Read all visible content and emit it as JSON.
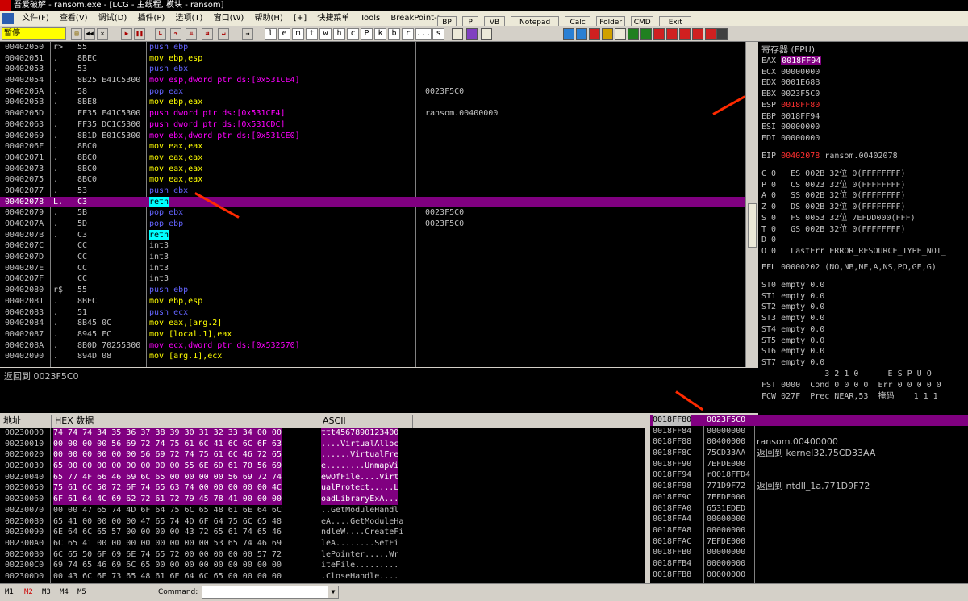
{
  "title": "吾爱破解 - ransom.exe - [LCG - 主线程, 模块 - ransom]",
  "menu": [
    "文件(F)",
    "查看(V)",
    "调试(D)",
    "插件(P)",
    "选项(T)",
    "窗口(W)",
    "帮助(H)",
    "[+]",
    "快捷菜单",
    "Tools",
    "BreakPoint->"
  ],
  "tool_buttons": [
    "BP",
    "P",
    "VB",
    "Notepad",
    "Calc",
    "Folder",
    "CMD",
    "Exit"
  ],
  "status": "暂停",
  "letter_buttons": [
    "l",
    "e",
    "m",
    "t",
    "w",
    "h",
    "c",
    "P",
    "k",
    "b",
    "r",
    "...",
    "s"
  ],
  "disasm": [
    {
      "addr": "00402050",
      "mark": "r>",
      "hex": "55",
      "inst": "push ebp",
      "cls": "k-push",
      "cmt": ""
    },
    {
      "addr": "00402051",
      "mark": ".",
      "hex": "8BEC",
      "inst": "mov ebp,esp",
      "cls": "k-mov",
      "cmt": ""
    },
    {
      "addr": "00402053",
      "mark": ".",
      "hex": "53",
      "inst": "push ebx",
      "cls": "k-push",
      "cmt": ""
    },
    {
      "addr": "00402054",
      "mark": ".",
      "hex": "8B25 E41C5300",
      "inst": "mov esp,dword ptr ds:[0x531CE4]",
      "cls": "k-mag",
      "cmt": ""
    },
    {
      "addr": "0040205A",
      "mark": ".",
      "hex": "58",
      "inst": "pop eax",
      "cls": "k-push",
      "cmt": "0023F5C0"
    },
    {
      "addr": "0040205B",
      "mark": ".",
      "hex": "8BE8",
      "inst": "mov ebp,eax",
      "cls": "k-mov",
      "cmt": ""
    },
    {
      "addr": "0040205D",
      "mark": ".",
      "hex": "FF35 F41C5300",
      "inst": "push dword ptr ds:[0x531CF4]",
      "cls": "k-mag",
      "cmt": "ransom.00400000"
    },
    {
      "addr": "00402063",
      "mark": ".",
      "hex": "FF35 DC1C5300",
      "inst": "push dword ptr ds:[0x531CDC]",
      "cls": "k-mag",
      "cmt": ""
    },
    {
      "addr": "00402069",
      "mark": ".",
      "hex": "8B1D E01C5300",
      "inst": "mov ebx,dword ptr ds:[0x531CE0]",
      "cls": "k-mag",
      "cmt": ""
    },
    {
      "addr": "0040206F",
      "mark": ".",
      "hex": "8BC0",
      "inst": "mov eax,eax",
      "cls": "k-mov",
      "cmt": ""
    },
    {
      "addr": "00402071",
      "mark": ".",
      "hex": "8BC0",
      "inst": "mov eax,eax",
      "cls": "k-mov",
      "cmt": ""
    },
    {
      "addr": "00402073",
      "mark": ".",
      "hex": "8BC0",
      "inst": "mov eax,eax",
      "cls": "k-mov",
      "cmt": ""
    },
    {
      "addr": "00402075",
      "mark": ".",
      "hex": "8BC0",
      "inst": "mov eax,eax",
      "cls": "k-mov",
      "cmt": ""
    },
    {
      "addr": "00402077",
      "mark": ".",
      "hex": "53",
      "inst": "push ebx",
      "cls": "k-push",
      "cmt": ""
    },
    {
      "addr": "00402078",
      "mark": "L.",
      "hex": "C3",
      "inst": "retn",
      "cls": "k-retn",
      "cmt": "",
      "hl": true
    },
    {
      "addr": "00402079",
      "mark": ".",
      "hex": "5B",
      "inst": "pop ebx",
      "cls": "k-push",
      "cmt": "0023F5C0"
    },
    {
      "addr": "0040207A",
      "mark": ".",
      "hex": "5D",
      "inst": "pop ebp",
      "cls": "k-push",
      "cmt": "0023F5C0"
    },
    {
      "addr": "0040207B",
      "mark": ".",
      "hex": "C3",
      "inst": "retn",
      "cls": "k-retn",
      "cmt": ""
    },
    {
      "addr": "0040207C",
      "mark": "",
      "hex": "CC",
      "inst": "int3",
      "cls": "k-int",
      "cmt": ""
    },
    {
      "addr": "0040207D",
      "mark": "",
      "hex": "CC",
      "inst": "int3",
      "cls": "k-int",
      "cmt": ""
    },
    {
      "addr": "0040207E",
      "mark": "",
      "hex": "CC",
      "inst": "int3",
      "cls": "k-int",
      "cmt": ""
    },
    {
      "addr": "0040207F",
      "mark": "",
      "hex": "CC",
      "inst": "int3",
      "cls": "k-int",
      "cmt": ""
    },
    {
      "addr": "00402080",
      "mark": "r$",
      "hex": "55",
      "inst": "push ebp",
      "cls": "k-push",
      "cmt": ""
    },
    {
      "addr": "00402081",
      "mark": ".",
      "hex": "8BEC",
      "inst": "mov ebp,esp",
      "cls": "k-mov",
      "cmt": ""
    },
    {
      "addr": "00402083",
      "mark": ".",
      "hex": "51",
      "inst": "push ecx",
      "cls": "k-push",
      "cmt": ""
    },
    {
      "addr": "00402084",
      "mark": ".",
      "hex": "8B45 0C",
      "inst": "mov eax,[arg.2]",
      "cls": "k-mov",
      "cmt": ""
    },
    {
      "addr": "00402087",
      "mark": ".",
      "hex": "8945 FC",
      "inst": "mov [local.1],eax",
      "cls": "k-mov",
      "cmt": ""
    },
    {
      "addr": "0040208A",
      "mark": ".",
      "hex": "8B0D 70255300",
      "inst": "mov ecx,dword ptr ds:[0x532570]",
      "cls": "k-mag",
      "cmt": ""
    },
    {
      "addr": "00402090",
      "mark": ".",
      "hex": "894D 08",
      "inst": "mov [arg.1],ecx",
      "cls": "k-mov",
      "cmt": ""
    }
  ],
  "info_line": "返回到 0023F5C0",
  "regs_title": "寄存器 (FPU)",
  "regs": [
    {
      "n": "EAX",
      "v": "0018FF94",
      "box": true
    },
    {
      "n": "ECX",
      "v": "00000000"
    },
    {
      "n": "EDX",
      "v": "0001E68B"
    },
    {
      "n": "EBX",
      "v": "0023F5C0"
    },
    {
      "n": "ESP",
      "v": "0018FF80",
      "red": true
    },
    {
      "n": "EBP",
      "v": "0018FF94"
    },
    {
      "n": "ESI",
      "v": "00000000"
    },
    {
      "n": "EDI",
      "v": "00000000"
    }
  ],
  "eip": {
    "n": "EIP",
    "v": "00402078",
    "c": "ransom.00402078"
  },
  "flags": [
    "C 0   ES 002B 32位 0(FFFFFFFF)",
    "P 0   CS 0023 32位 0(FFFFFFFF)",
    "A 0   SS 002B 32位 0(FFFFFFFF)",
    "Z 0   DS 002B 32位 0(FFFFFFFF)",
    "S 0   FS 0053 32位 7EFDD000(FFF)",
    "T 0   GS 002B 32位 0(FFFFFFFF)",
    "D 0",
    "O 0   LastErr ERROR_RESOURCE_TYPE_NOT_"
  ],
  "efl": "EFL 00000202 (NO,NB,NE,A,NS,PO,GE,G)",
  "fpu": [
    "ST0 empty 0.0",
    "ST1 empty 0.0",
    "ST2 empty 0.0",
    "ST3 empty 0.0",
    "ST4 empty 0.0",
    "ST5 empty 0.0",
    "ST6 empty 0.0",
    "ST7 empty 0.0"
  ],
  "fpu_hdr": "             3 2 1 0      E S P U O",
  "fst": "FST 0000  Cond 0 0 0 0  Err 0 0 0 0 0",
  "fcw": "FCW 027F  Prec NEAR,53  掩码    1 1 1",
  "dump_headers": {
    "addr": "地址",
    "hex": "HEX 数据",
    "ascii": "ASCII"
  },
  "dump": [
    {
      "a": "00230000",
      "h": "74 74 74 34 35 36 37 38 39 30 31 32 33 34 00 00",
      "s": "ttt4567890123400"
    },
    {
      "a": "00230010",
      "h": "00 00 00 00 56 69 72 74 75 61 6C 41 6C 6C 6F 63",
      "s": "....VirtualAlloc"
    },
    {
      "a": "00230020",
      "h": "00 00 00 00 00 00 56 69 72 74 75 61 6C 46 72 65",
      "s": "......VirtualFre"
    },
    {
      "a": "00230030",
      "h": "65 00 00 00 00 00 00 00 00 55 6E 6D 61 70 56 69",
      "s": "e........UnmapVi"
    },
    {
      "a": "00230040",
      "h": "65 77 4F 66 46 69 6C 65 00 00 00 00 56 69 72 74",
      "s": "ewOfFile....Virt"
    },
    {
      "a": "00230050",
      "h": "75 61 6C 50 72 6F 74 65 63 74 00 00 00 00 00 4C",
      "s": "ualProtect.....L"
    },
    {
      "a": "00230060",
      "h": "6F 61 64 4C 69 62 72 61 72 79 45 78 41 00 00 00",
      "s": "oadLibraryExA..."
    },
    {
      "a": "00230070",
      "h": "00 00 47 65 74 4D 6F 64 75 6C 65 48 61 6E 64 6C",
      "s": "..GetModuleHandl"
    },
    {
      "a": "00230080",
      "h": "65 41 00 00 00 00 47 65 74 4D 6F 64 75 6C 65 48",
      "s": "eA....GetModuleHa"
    },
    {
      "a": "00230090",
      "h": "6E 64 6C 65 57 00 00 00 00 43 72 65 61 74 65 46",
      "s": "ndleW....CreateFi"
    },
    {
      "a": "002300A0",
      "h": "6C 65 41 00 00 00 00 00 00 00 00 53 65 74 46 69",
      "s": "leA........SetFi"
    },
    {
      "a": "002300B0",
      "h": "6C 65 50 6F 69 6E 74 65 72 00 00 00 00 00 57 72",
      "s": "lePointer.....Wr"
    },
    {
      "a": "002300C0",
      "h": "69 74 65 46 69 6C 65 00 00 00 00 00 00 00 00 00",
      "s": "iteFile........."
    },
    {
      "a": "002300D0",
      "h": "00 43 6C 6F 73 65 48 61 6E 64 6C 65 00 00 00 00",
      "s": ".CloseHandle...."
    }
  ],
  "stack": [
    {
      "a": "0018FF80",
      "v": "0023F5C0",
      "c": "",
      "hl": true
    },
    {
      "a": "0018FF84",
      "v": "00000000",
      "c": ""
    },
    {
      "a": "0018FF88",
      "v": "00400000",
      "c": "ransom.00400000"
    },
    {
      "a": "0018FF8C",
      "v": "75CD33AA",
      "c": "返回到 kernel32.75CD33AA"
    },
    {
      "a": "0018FF90",
      "v": "7EFDE000",
      "c": ""
    },
    {
      "a": "0018FF94",
      "v": "r0018FFD4",
      "c": ""
    },
    {
      "a": "0018FF98",
      "v": "771D9F72",
      "c": "返回到 ntdll_1a.771D9F72"
    },
    {
      "a": "0018FF9C",
      "v": "7EFDE000",
      "c": ""
    },
    {
      "a": "0018FFA0",
      "v": "6531EDED",
      "c": ""
    },
    {
      "a": "0018FFA4",
      "v": "00000000",
      "c": ""
    },
    {
      "a": "0018FFA8",
      "v": "00000000",
      "c": ""
    },
    {
      "a": "0018FFAC",
      "v": "7EFDE000",
      "c": ""
    },
    {
      "a": "0018FFB0",
      "v": "00000000",
      "c": ""
    },
    {
      "a": "0018FFB4",
      "v": "00000000",
      "c": ""
    },
    {
      "a": "0018FFB8",
      "v": "00000000",
      "c": ""
    }
  ],
  "bottom": {
    "tabs": [
      "M1",
      "M2",
      "M3",
      "M4",
      "M5"
    ],
    "command_label": "Command:"
  }
}
